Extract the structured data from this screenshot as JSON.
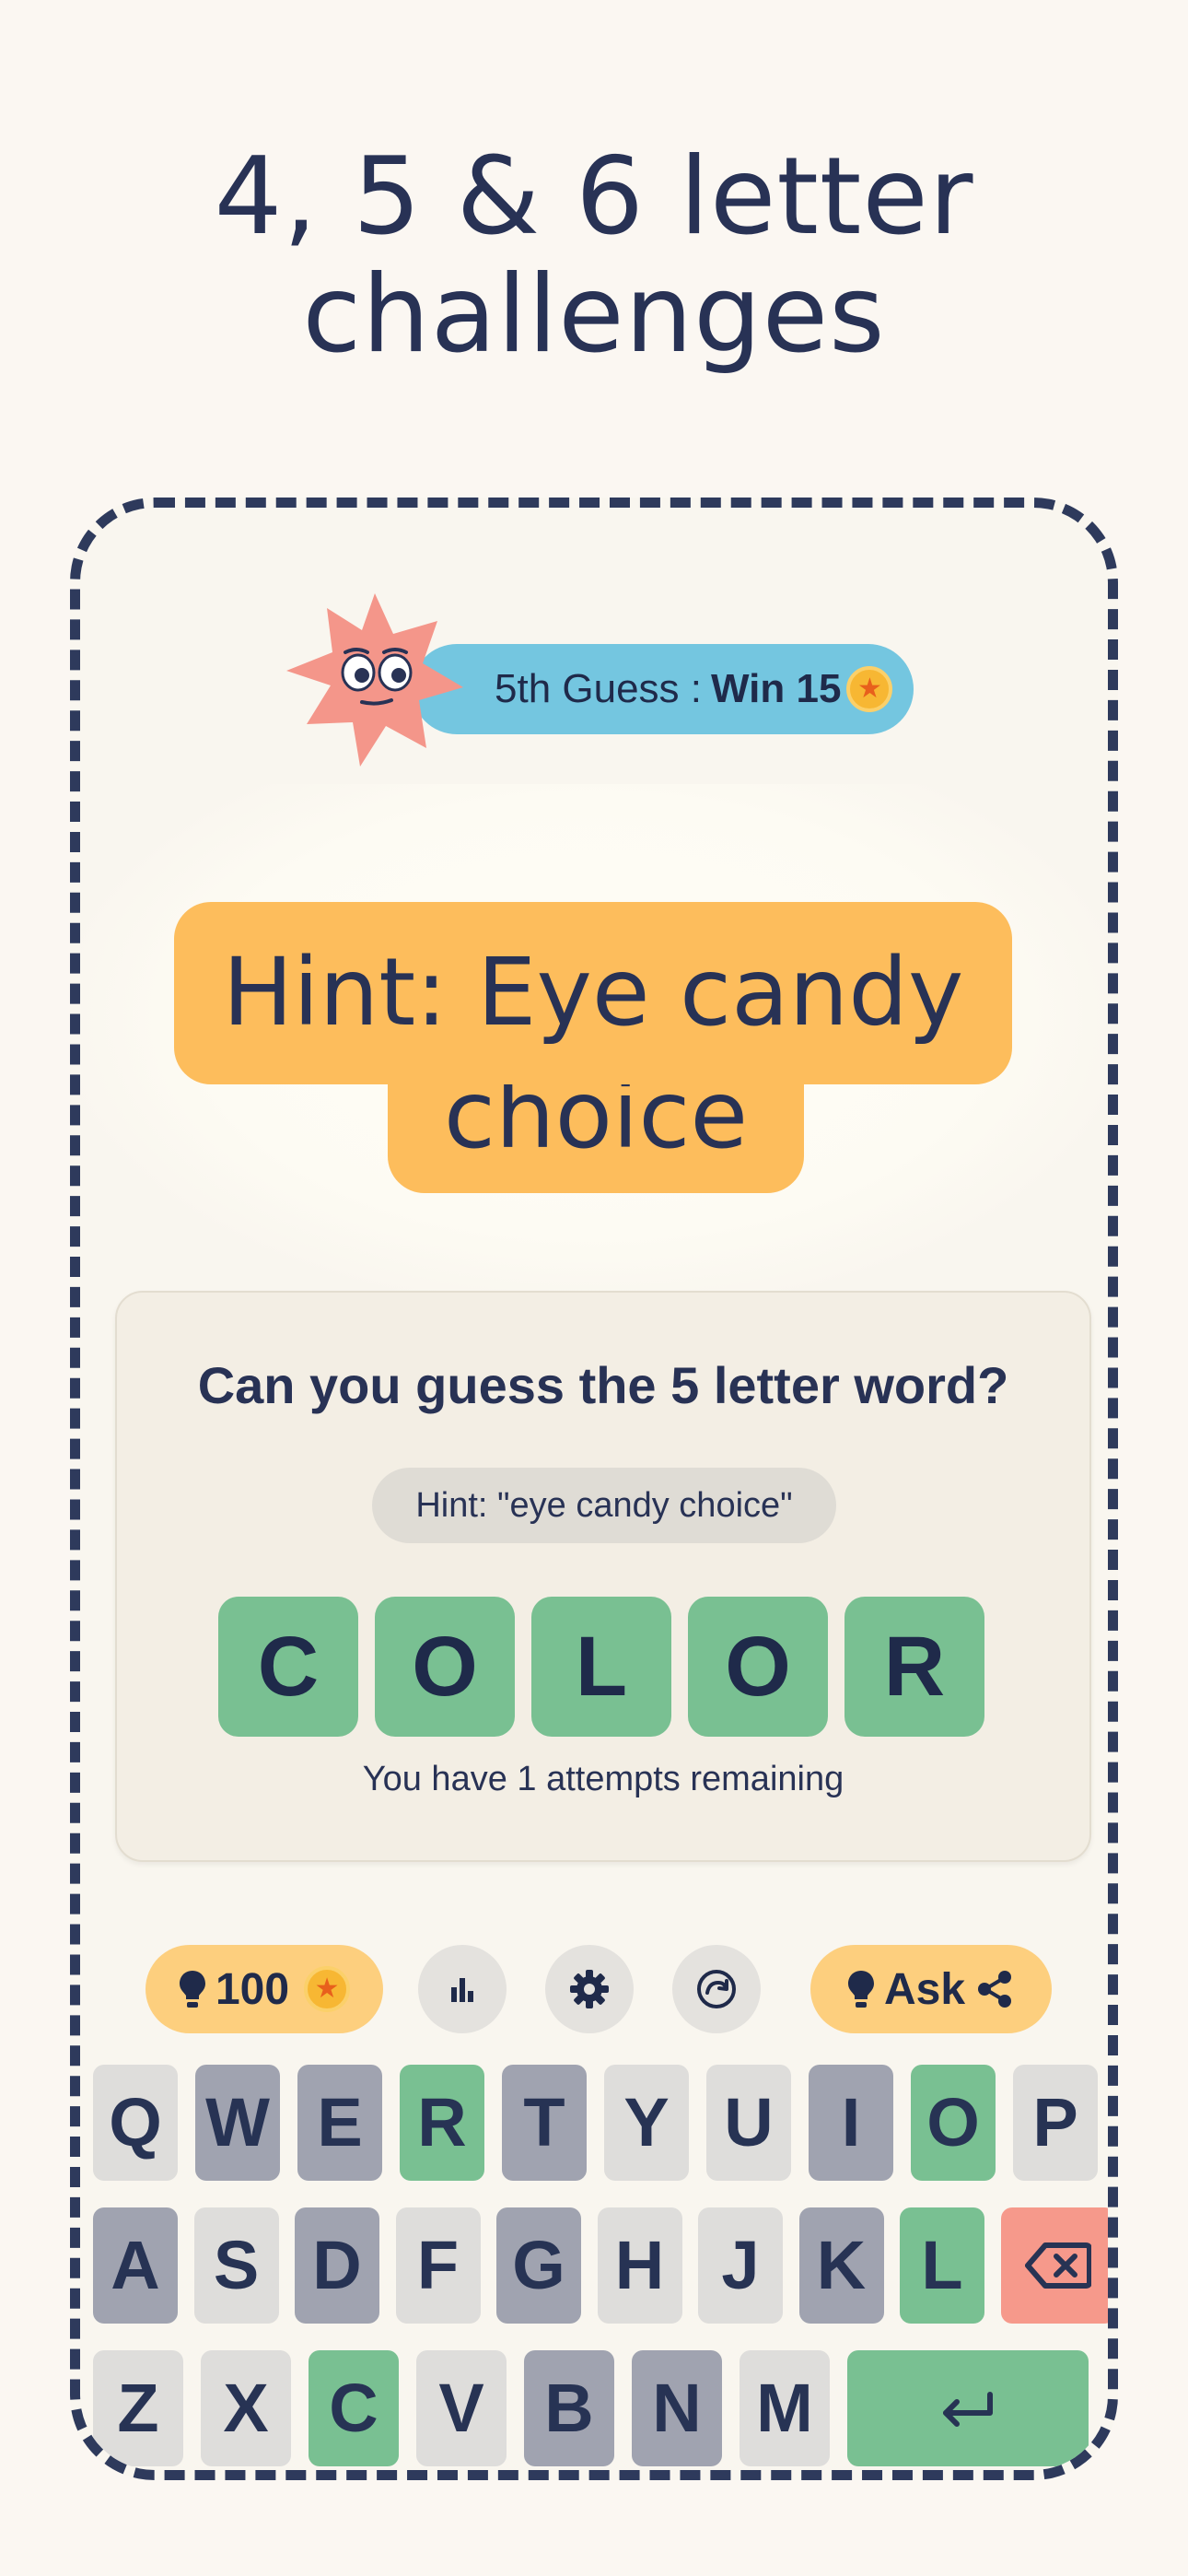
{
  "headline": {
    "line1": "4, 5 & 6 letter",
    "line2": "challenges"
  },
  "badge": {
    "guess_text": "5th Guess : ",
    "win_text": "Win 15"
  },
  "hint_bubble": {
    "line1": "Hint: Eye candy",
    "line2": "choice"
  },
  "card": {
    "title": "Can you guess the 5 letter word?",
    "hint_chip": "Hint: \"eye candy choice\"",
    "tiles": [
      "C",
      "O",
      "L",
      "O",
      "R"
    ],
    "attempts_text": "You have 1 attempts remaining"
  },
  "toolbar": {
    "hints_count": "100",
    "ask_label": "Ask",
    "icons": [
      "lightbulb-icon",
      "coin-icon",
      "stats-icon",
      "gear-icon",
      "refresh-icon",
      "share-icon"
    ]
  },
  "keyboard": {
    "rows": [
      [
        {
          "k": "Q",
          "s": "default"
        },
        {
          "k": "W",
          "s": "absent"
        },
        {
          "k": "E",
          "s": "absent"
        },
        {
          "k": "R",
          "s": "correct"
        },
        {
          "k": "T",
          "s": "absent"
        },
        {
          "k": "Y",
          "s": "default"
        },
        {
          "k": "U",
          "s": "default"
        },
        {
          "k": "I",
          "s": "absent"
        },
        {
          "k": "O",
          "s": "correct"
        },
        {
          "k": "P",
          "s": "default"
        }
      ],
      [
        {
          "k": "A",
          "s": "absent"
        },
        {
          "k": "S",
          "s": "default"
        },
        {
          "k": "D",
          "s": "absent"
        },
        {
          "k": "F",
          "s": "default"
        },
        {
          "k": "G",
          "s": "absent"
        },
        {
          "k": "H",
          "s": "default"
        },
        {
          "k": "J",
          "s": "default"
        },
        {
          "k": "K",
          "s": "absent"
        },
        {
          "k": "L",
          "s": "correct"
        },
        {
          "k": "⌫",
          "s": "delete"
        }
      ],
      [
        {
          "k": "Z",
          "s": "default"
        },
        {
          "k": "X",
          "s": "default"
        },
        {
          "k": "C",
          "s": "correct"
        },
        {
          "k": "V",
          "s": "default"
        },
        {
          "k": "B",
          "s": "absent"
        },
        {
          "k": "N",
          "s": "absent"
        },
        {
          "k": "M",
          "s": "default"
        },
        {
          "k": "↵",
          "s": "correct"
        }
      ]
    ]
  },
  "colors": {
    "background": "#fbf7f2",
    "ink": "#283255",
    "correct": "#79c092",
    "absent": "#a0a3b0",
    "key_default": "#dedddb",
    "delete": "#f6998b",
    "hint_orange": "#fdbd5c",
    "guess_blue": "#74c6e0"
  }
}
